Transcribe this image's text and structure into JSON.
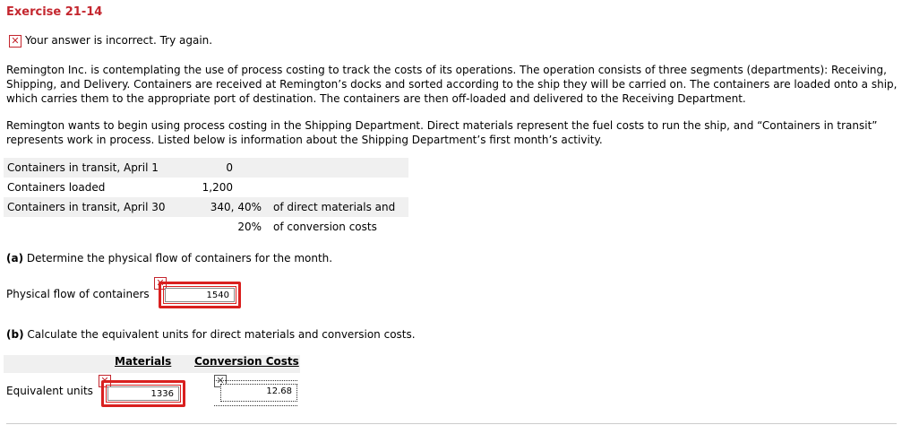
{
  "exercise_title": "Exercise 21-14",
  "status": {
    "icon": "x-icon",
    "message": "Your answer is incorrect.  Try again."
  },
  "paragraphs": [
    "Remington Inc. is contemplating the use of process costing to track the costs of its operations. The operation consists of three segments (departments): Receiving, Shipping, and Delivery. Containers are received at Remington’s docks and sorted according to the ship they will be carried on. The containers are loaded onto a ship, which carries them to the appropriate port of destination. The containers are then off-loaded and delivered to the Receiving Department.",
    "Remington wants to begin using process costing in the Shipping Department. Direct materials represent the fuel costs to run the ship, and “Containers in transit” represents work in process. Listed below is information about the Shipping Department’s first month’s activity."
  ],
  "activity_table": {
    "rows": [
      {
        "label": "Containers in transit, April 1",
        "value": "0",
        "note": ""
      },
      {
        "label": "Containers loaded",
        "value": "1,200",
        "note": ""
      },
      {
        "label": "Containers in transit, April 30",
        "value": "340, 40%",
        "note": "of direct materials and"
      },
      {
        "label": "",
        "value": "20%",
        "note": "of conversion costs"
      }
    ]
  },
  "part_a": {
    "question": "(a) Determine the physical flow of containers for the month.",
    "label": "Physical flow of containers",
    "answer": "1540"
  },
  "part_b": {
    "question": "(b) Calculate the equivalent units for direct materials and conversion costs.",
    "headers": {
      "materials": "Materials",
      "conversion": "Conversion Costs"
    },
    "row_label": "Equivalent units",
    "materials_answer": "1336",
    "conversion_answer": "12.68"
  },
  "colors": {
    "error_red": "#d9201f",
    "title_red": "#c4262e",
    "table_shade": "#f0f0f0"
  }
}
